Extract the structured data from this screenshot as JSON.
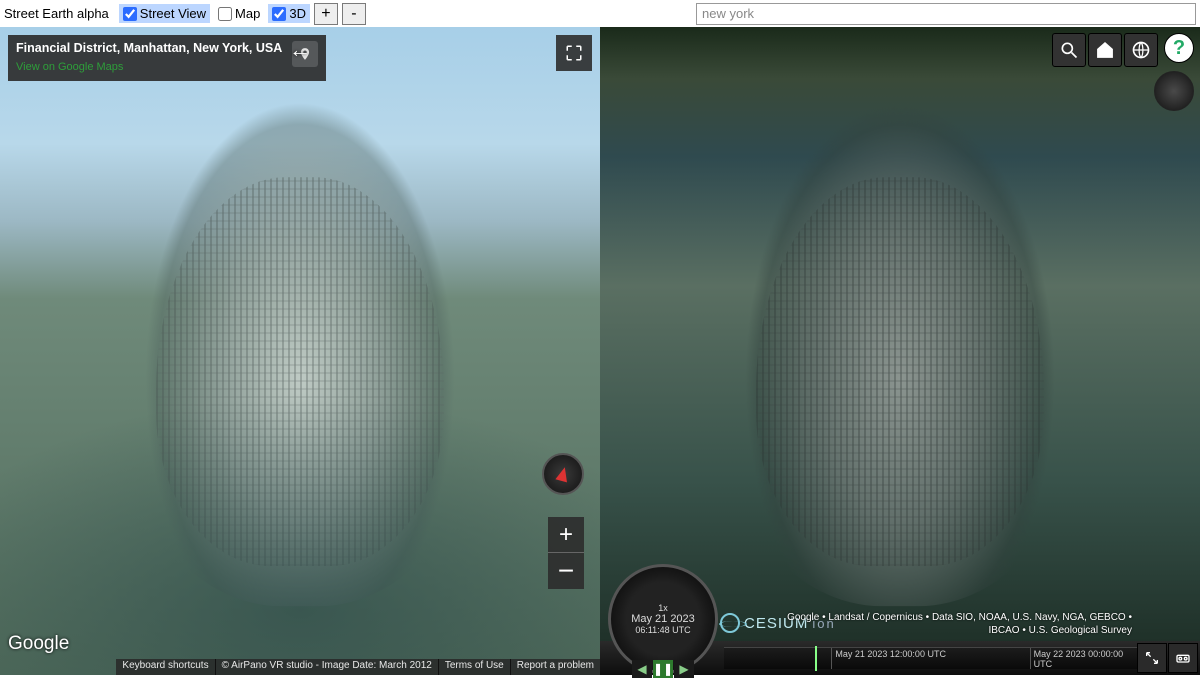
{
  "app": {
    "title": "Street Earth alpha"
  },
  "toolbar": {
    "toggles": {
      "streetview": {
        "label": "Street View",
        "checked": true
      },
      "map": {
        "label": "Map",
        "checked": false
      },
      "three_d": {
        "label": "3D",
        "checked": true
      }
    },
    "plus": "+",
    "minus": "-",
    "search_value": "new york"
  },
  "left": {
    "location_line": "Financial District, Manhattan, New York, USA",
    "gmaps_link": "View on Google Maps",
    "google_logo": "Google",
    "footer": {
      "shortcuts": "Keyboard shortcuts",
      "credit": "© AirPano VR studio - Image Date: March 2012",
      "terms": "Terms of Use",
      "report": "Report a problem"
    },
    "zoom_in": "+",
    "zoom_out": "−"
  },
  "right": {
    "attrib_line1": "Google • Landsat / Copernicus • Data SIO, NOAA, U.S. Navy, NGA, GEBCO •",
    "attrib_line2": "IBCAO • U.S. Geological Survey",
    "cesium": "CESIUM",
    "ion": "ion",
    "timeline": {
      "speed": "1x",
      "date": "May 21 2023",
      "time": "06:11:48 UTC",
      "tick1": "May 21 2023 12:00:00 UTC",
      "tick2": "May 22 2023 00:00:00 UTC",
      "rev": "◀",
      "pause": "❚❚",
      "fwd": "▶"
    },
    "help": "?"
  }
}
